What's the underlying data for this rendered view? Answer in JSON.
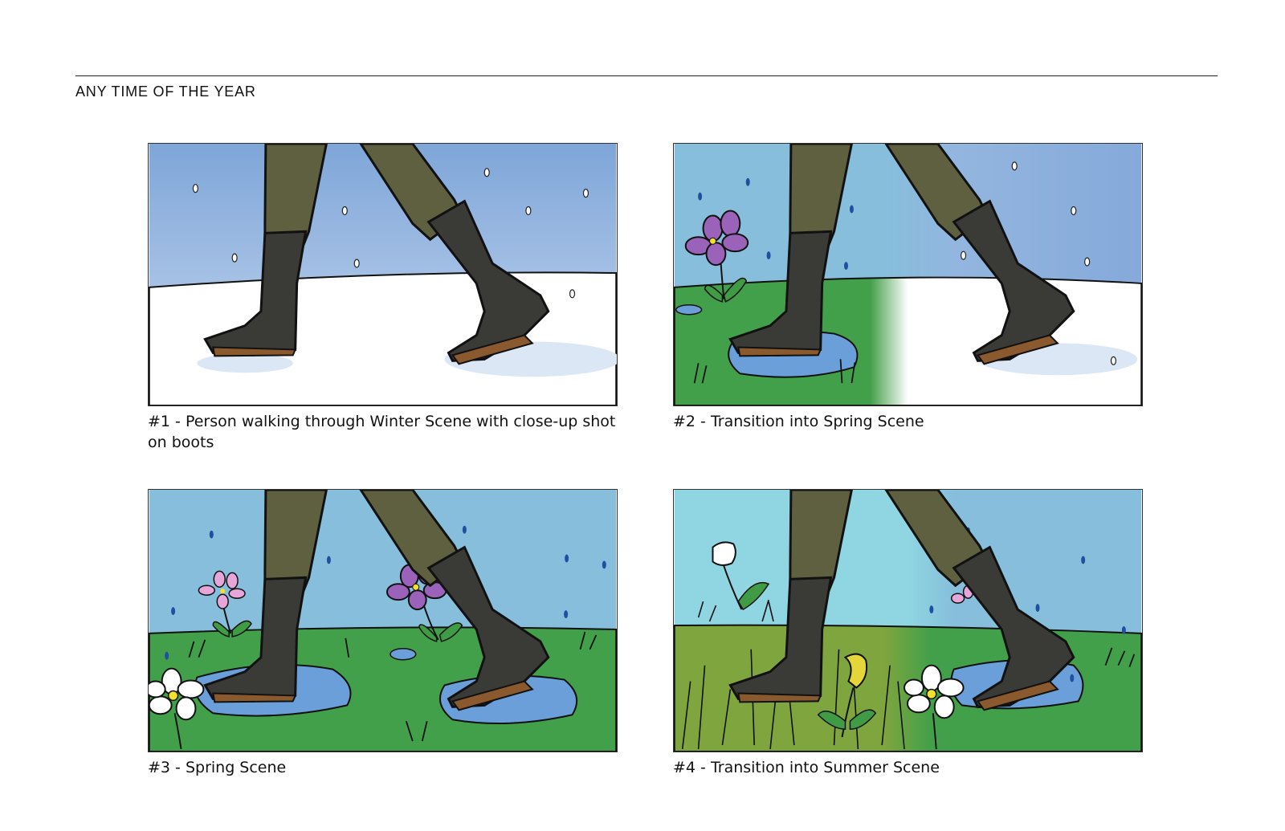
{
  "document": {
    "title": "ANY TIME OF THE YEAR"
  },
  "panels": [
    {
      "caption": "#1 - Person walking through Winter Scene with close-up shot on boots"
    },
    {
      "caption": "#2 - Transition into Spring Scene"
    },
    {
      "caption": "#3 - Spring Scene"
    },
    {
      "caption": "#4 - Transition into Summer Scene"
    }
  ],
  "colors": {
    "winter_sky": "#7ea6d8",
    "spring_sky": "#86bedb",
    "summer_sky": "#8fd6e2",
    "snow": "#ffffff",
    "grass": "#43a04a",
    "summer_grass": "#7ea53e",
    "puddle": "#6a9fda",
    "legs": "#5f6040",
    "boot": "#3a3a36",
    "sole": "#8a5a2e"
  }
}
